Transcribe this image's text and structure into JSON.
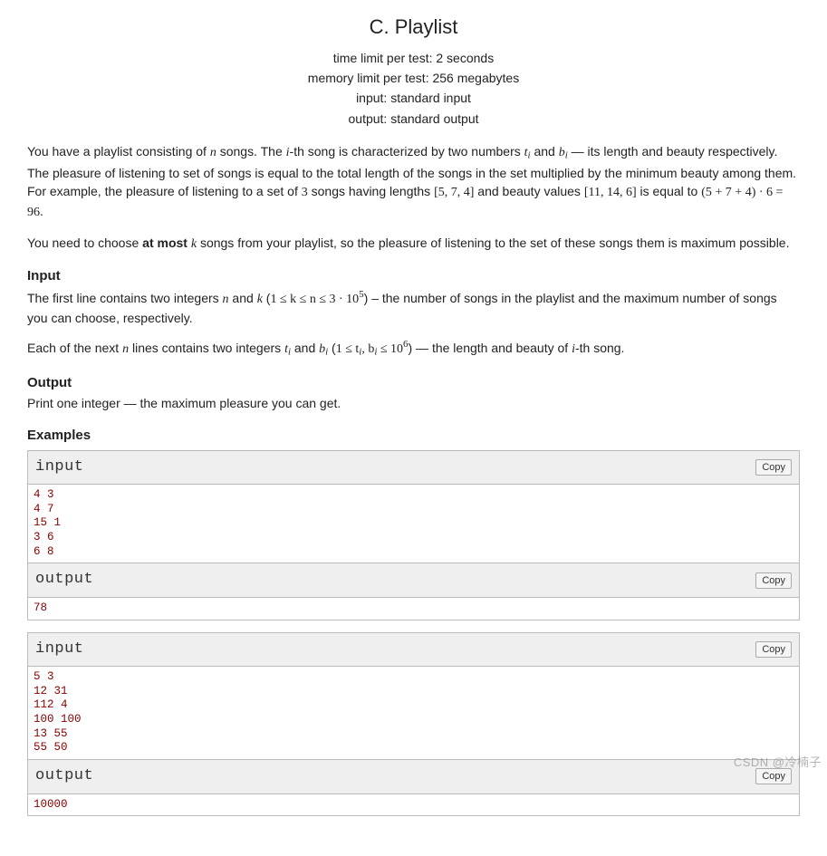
{
  "title": "C. Playlist",
  "limits": {
    "time": "time limit per test: 2 seconds",
    "memory": "memory limit per test: 256 megabytes",
    "input": "input: standard input",
    "output": "output: standard output"
  },
  "statement": {
    "p1_a": "You have a playlist consisting of ",
    "n": "n",
    "p1_b": " songs. The ",
    "i": "i",
    "p1_c": "-th song is characterized by two numbers ",
    "ti": "t",
    "p1_d": " and ",
    "bi": "b",
    "p1_e": " — its length and beauty respectively. The pleasure of listening to set of songs is equal to the total length of the songs in the set multiplied by the minimum beauty among them. For example, the pleasure of listening to a set of ",
    "three": "3",
    "p1_f": " songs having lengths ",
    "arr1": "[5, 7, 4]",
    "p1_g": " and beauty values ",
    "arr2": "[11, 14, 6]",
    "p1_h": " is equal to ",
    "expr": "(5 + 7 + 4) · 6 = 96",
    "p1_end": ".",
    "p2_a": "You need to choose ",
    "atmost": "at most ",
    "k": "k",
    "p2_b": " songs from your playlist, so the pleasure of listening to the set of these songs them is maximum possible."
  },
  "input": {
    "title": "Input",
    "p1_a": "The first line contains two integers ",
    "p1_b": " and ",
    "p1_c": " (",
    "constraint1": "1 ≤ k ≤ n ≤ 3 · 10",
    "constraint1_sup": "5",
    "p1_d": ") – the number of songs in the playlist and the maximum number of songs you can choose, respectively.",
    "p2_a": "Each of the next ",
    "p2_b": " lines contains two integers ",
    "p2_c": " and ",
    "p2_d": " (",
    "constraint2a": "1 ≤ t",
    "constraint2b": ", b",
    "constraint2c": " ≤ 10",
    "constraint2_sup": "6",
    "p2_e": ") — the length and beauty of ",
    "p2_f": "-th song."
  },
  "output": {
    "title": "Output",
    "text": "Print one integer — the maximum pleasure you can get."
  },
  "examples_title": "Examples",
  "io_labels": {
    "input": "input",
    "output": "output",
    "copy": "Copy"
  },
  "examples": [
    {
      "input": "4 3\n4 7\n15 1\n3 6\n6 8",
      "output": "78"
    },
    {
      "input": "5 3\n12 31\n112 4\n100 100\n13 55\n55 50",
      "output": "10000"
    }
  ],
  "watermark": "CSDN @冷楠子"
}
